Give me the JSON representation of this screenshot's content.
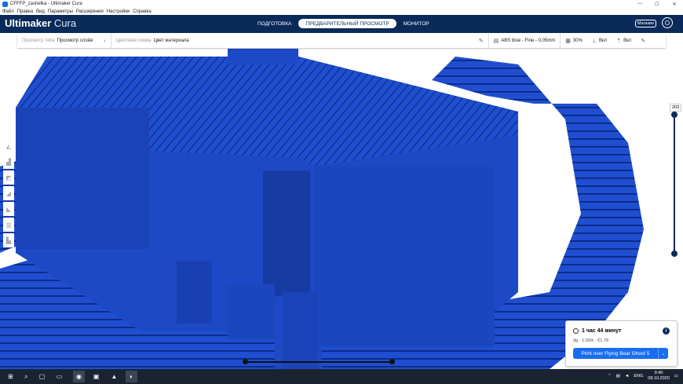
{
  "window": {
    "title": "CFFFP_zashelka - Ultimaker Cura",
    "controls": [
      "—",
      "☐",
      "✕"
    ]
  },
  "menu": [
    "Файл",
    "Правка",
    "Вид",
    "Параметры",
    "Расширения",
    "Настройки",
    "Справка"
  ],
  "header": {
    "brand": "Ultimaker",
    "brand_sub": "Cura",
    "stages": [
      "ПОДГОТОВКА",
      "ПРЕДВАРИТЕЛЬНЫЙ ПРОСМОТР",
      "МОНИТОР"
    ],
    "active_stage": "ПРЕДВАРИТЕЛЬНЫЙ ПРОСМОТР",
    "store_label": "Магазин",
    "account_initial": "O"
  },
  "infobar": {
    "view_type_label": "Просмотр типа",
    "view_type_value": "Просмотр слоёв",
    "color_scheme_label": "Цветовая схема",
    "color_scheme_value": "Цвет материала",
    "profile": "ABS blue - Fine - 0,05mm",
    "infill": "30%",
    "support": "Вкл",
    "adhesion": "Вкл"
  },
  "layer_slider": {
    "current_layer": "203"
  },
  "print_panel": {
    "time": "1 час 44 минут",
    "material": "3g · 1.02m · €1.79",
    "print_button": "Print over Flying Bear Ghost 5"
  },
  "taskbar": {
    "language": "ENG",
    "time": "9:40",
    "date": "08.10.2020"
  },
  "colors": {
    "accent": "#196ef0",
    "header": "#0a2a5a",
    "model": "#1f4fd0"
  }
}
